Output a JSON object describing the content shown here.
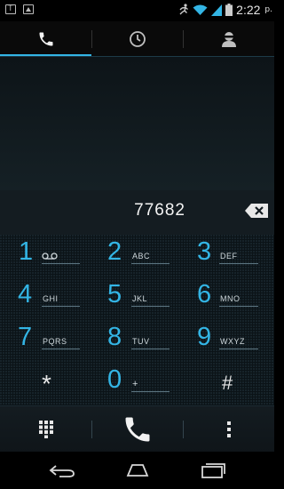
{
  "status_bar": {
    "time": "2:22",
    "ampm": "p.",
    "notification_icons": [
      "text-icon",
      "image-icon"
    ],
    "status_icons": [
      "running-icon",
      "wifi-icon",
      "signal-icon",
      "battery-icon"
    ]
  },
  "tabs": [
    {
      "name": "tab-phone",
      "icon": "phone-icon",
      "active": true
    },
    {
      "name": "tab-call-log",
      "icon": "clock-icon",
      "active": false
    },
    {
      "name": "tab-contacts",
      "icon": "person-icon",
      "active": false
    }
  ],
  "dialer": {
    "digits": "77682"
  },
  "keypad": {
    "keys": [
      {
        "num": "1",
        "letters": ""
      },
      {
        "num": "2",
        "letters": "ABC"
      },
      {
        "num": "3",
        "letters": "DEF"
      },
      {
        "num": "4",
        "letters": "GHI"
      },
      {
        "num": "5",
        "letters": "JKL"
      },
      {
        "num": "6",
        "letters": "MNO"
      },
      {
        "num": "7",
        "letters": "PQRS"
      },
      {
        "num": "8",
        "letters": "TUV"
      },
      {
        "num": "9",
        "letters": "WXYZ"
      },
      {
        "num": "*",
        "letters": ""
      },
      {
        "num": "0",
        "letters": "+"
      },
      {
        "num": "#",
        "letters": ""
      }
    ]
  },
  "actions": [
    "dialpad-icon",
    "call-icon",
    "overflow-icon"
  ],
  "colors": {
    "accent": "#33b5e5",
    "background": "#000000"
  }
}
